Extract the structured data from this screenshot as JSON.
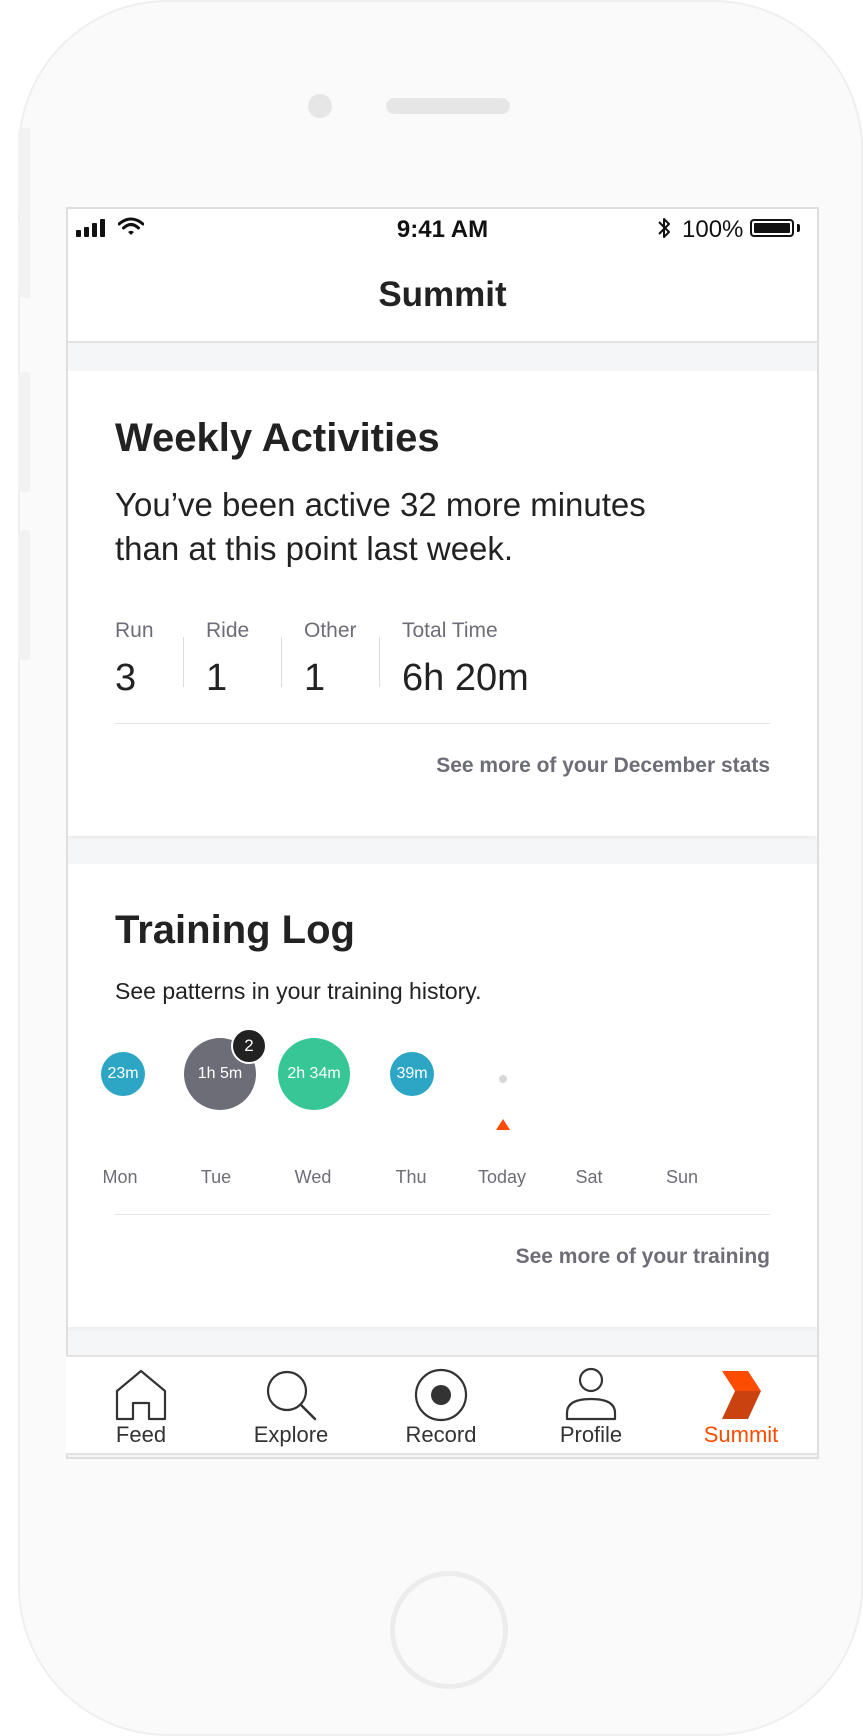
{
  "status_bar": {
    "time": "9:41 AM",
    "battery": "100%"
  },
  "nav": {
    "title": "Summit"
  },
  "weekly": {
    "title": "Weekly Activities",
    "description": "You’ve been active 32 more minutes than at this point last week.",
    "stats": [
      {
        "label": "Run",
        "value": "3"
      },
      {
        "label": "Ride",
        "value": "1"
      },
      {
        "label": "Other",
        "value": "1"
      },
      {
        "label": "Total Time",
        "value": "6h 20m"
      }
    ],
    "see_more": "See more of your December stats"
  },
  "training": {
    "title": "Training Log",
    "description": "See patterns in your training history.",
    "days": [
      "Mon",
      "Tue",
      "Wed",
      "Thu",
      "Today",
      "Sat",
      "Sun"
    ],
    "activities": {
      "mon": "23m",
      "tue": "1h 5m",
      "tue_count": "2",
      "wed": "2h 34m",
      "thu": "39m"
    },
    "see_more": "See more of your training"
  },
  "tabs": [
    {
      "label": "Feed",
      "icon": "home-icon"
    },
    {
      "label": "Explore",
      "icon": "search-icon"
    },
    {
      "label": "Record",
      "icon": "record-icon"
    },
    {
      "label": "Profile",
      "icon": "profile-icon"
    },
    {
      "label": "Summit",
      "icon": "summit-chevron-icon"
    }
  ],
  "colors": {
    "accent": "#fc4c02",
    "run": "#2da6c6",
    "other": "#6d6d78",
    "ride": "#37c796"
  }
}
